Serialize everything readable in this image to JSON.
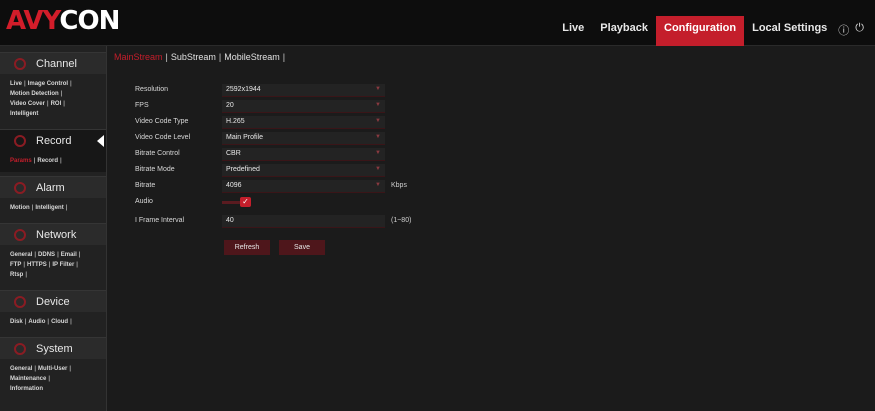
{
  "brand": {
    "logo_accent": "AVY",
    "logo_rest": "CON"
  },
  "header": {
    "nav": [
      "Live",
      "Playback",
      "Configuration",
      "Local Settings"
    ],
    "active": "Configuration",
    "icons": [
      "info-icon",
      "power-icon"
    ]
  },
  "sidebar": {
    "sections": [
      {
        "label": "Channel",
        "icon": "channel-icon",
        "links": [
          "Live",
          "Image Control",
          "Motion Detection",
          "Video Cover",
          "ROI",
          "Intelligent"
        ]
      },
      {
        "label": "Record",
        "icon": "record-icon",
        "active": true,
        "links": [
          "Params",
          "Record"
        ],
        "current": "Params"
      },
      {
        "label": "Alarm",
        "icon": "alarm-icon",
        "links": [
          "Motion",
          "Intelligent"
        ]
      },
      {
        "label": "Network",
        "icon": "network-icon",
        "links": [
          "General",
          "DDNS",
          "Email",
          "FTP",
          "HTTPS",
          "IP Filter",
          "Rtsp"
        ]
      },
      {
        "label": "Device",
        "icon": "device-icon",
        "links": [
          "Disk",
          "Audio",
          "Cloud"
        ]
      },
      {
        "label": "System",
        "icon": "system-icon",
        "links": [
          "General",
          "Multi-User",
          "Maintenance",
          "Information"
        ]
      }
    ]
  },
  "tabs": {
    "items": [
      "MainStream",
      "SubStream",
      "MobileStream"
    ],
    "current": "MainStream"
  },
  "form": {
    "resolution": {
      "label": "Resolution",
      "value": "2592x1944"
    },
    "fps": {
      "label": "FPS",
      "value": "20"
    },
    "video_code_type": {
      "label": "Video Code Type",
      "value": "H.265"
    },
    "video_code_level": {
      "label": "Video Code Level",
      "value": "Main Profile"
    },
    "bitrate_control": {
      "label": "Bitrate Control",
      "value": "CBR"
    },
    "bitrate_mode": {
      "label": "Bitrate Mode",
      "value": "Predefined"
    },
    "bitrate": {
      "label": "Bitrate",
      "value": "4096",
      "unit": "Kbps"
    },
    "audio": {
      "label": "Audio",
      "checked": true
    },
    "iframe_interval": {
      "label": "I Frame Interval",
      "value": "40",
      "range": "(1~80)"
    }
  },
  "buttons": {
    "refresh": "Refresh",
    "save": "Save"
  }
}
